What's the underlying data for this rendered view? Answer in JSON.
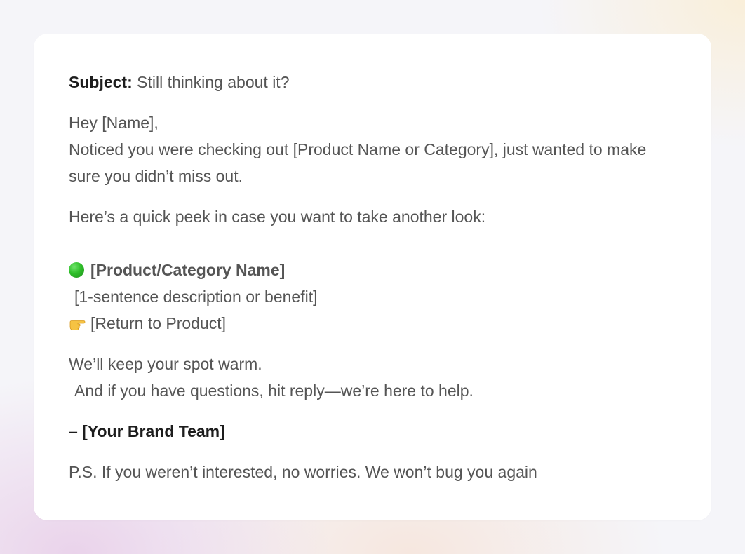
{
  "email": {
    "subject_label": "Subject:",
    "subject_text": " Still thinking about it?",
    "greeting": "Hey [Name],",
    "intro": "Noticed you were checking out [Product Name or Category], just wanted to make sure you didn’t miss out.",
    "peek": "Here’s a quick peek in case you want to take another look:",
    "product_icon": "green-circle-icon",
    "product_name": "[Product/Category Name]",
    "product_description": "[1-sentence description or benefit]",
    "return_icon": "pointing-hand-icon",
    "return_link": "[Return to Product]",
    "closing_line1": "We’ll keep your spot warm.",
    "closing_line2": "And if you have questions, hit reply—we’re here to help.",
    "signature": "– [Your Brand Team]",
    "ps": "P.S. If you weren’t interested, no worries. We won’t bug you again"
  },
  "colors": {
    "text": "#555555",
    "strong_text": "#1d1d1d",
    "card": "#ffffff",
    "accent_green": "#2fbf2a"
  }
}
